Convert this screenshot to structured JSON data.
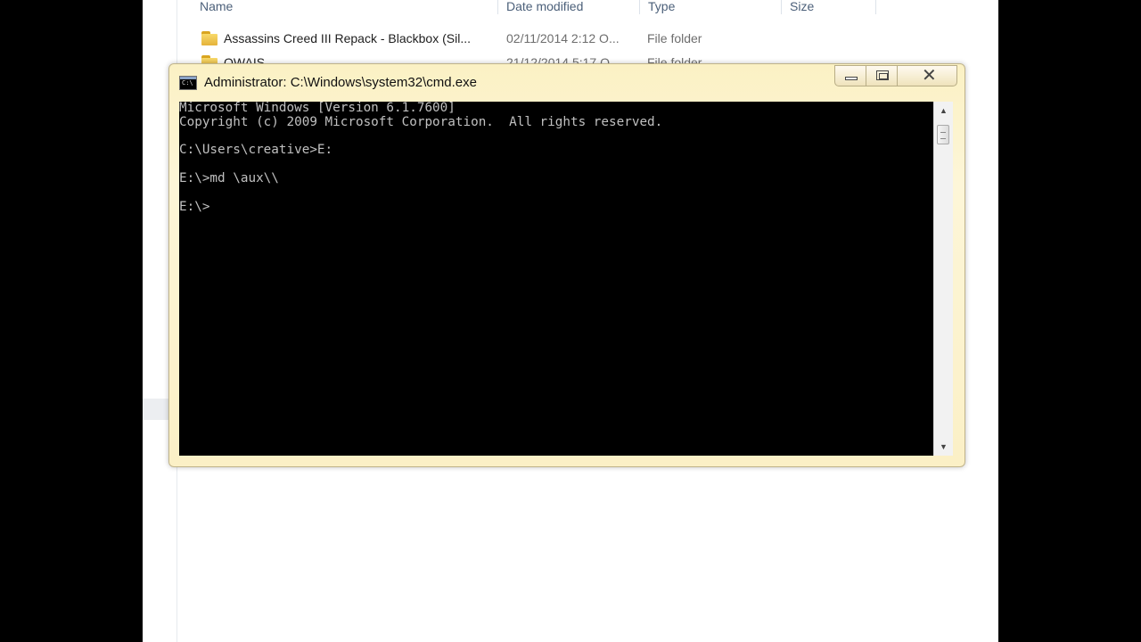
{
  "explorer": {
    "columns": [
      "Name",
      "Date modified",
      "Type",
      "Size"
    ],
    "rows": [
      {
        "name": "Assassins Creed III Repack - Blackbox (Sil...",
        "date": "02/11/2014 2:12 O...",
        "type": "File folder"
      },
      {
        "name": "OWAIS",
        "date": "21/12/2014 5:17 O...",
        "type": "File folder"
      }
    ]
  },
  "cmd": {
    "title": "Administrator: C:\\Windows\\system32\\cmd.exe",
    "icon_text": "C:\\",
    "lines": [
      "Microsoft Windows [Version 6.1.7600]",
      "Copyright (c) 2009 Microsoft Corporation.  All rights reserved.",
      "",
      "C:\\Users\\creative>E:",
      "",
      "E:\\>md \\aux\\\\",
      "",
      "E:\\>"
    ]
  }
}
